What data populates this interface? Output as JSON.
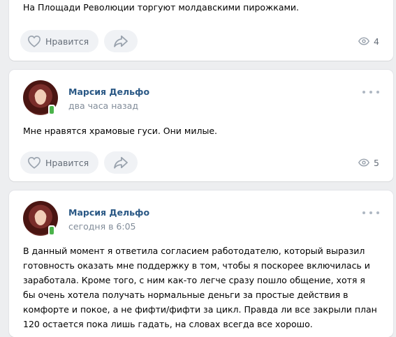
{
  "posts": [
    {
      "text": "На Площади Революции торгуют молдавскими пирожками.",
      "like_label": "Нравится",
      "views": "4"
    },
    {
      "author": "Марсия Дельфо",
      "time": "два часа назад",
      "text": "Мне нравятся храмовые гуси. Они милые.",
      "like_label": "Нравится",
      "views": "5"
    },
    {
      "author": "Марсия Дельфо",
      "time": "сегодня в 6:05",
      "text": "В данный момент я ответила согласием работодателю, который выразил готовность оказать мне поддержку в том, чтобы я поскорее включилась и заработала. Кроме того, с ним как-то легче сразу пошло общение, хотя я бы очень хотела получать нормальные деньги за простые действия в комфорте и покое, а не фифти/фифти за цикл. Правда ли все закрыли план 120 остается пока лишь гадать, на словах всегда все хорошо."
    }
  ],
  "icons": {
    "like": "heart-outline-icon",
    "share": "share-arrow-icon",
    "views": "eye-icon",
    "more": "more-dots-icon",
    "online": "mobile-online-icon"
  },
  "colors": {
    "background": "#edeef0",
    "author": "#2a5885",
    "secondary": "#818c99",
    "button_bg": "#f0f2f5",
    "online": "#4bb34b"
  }
}
